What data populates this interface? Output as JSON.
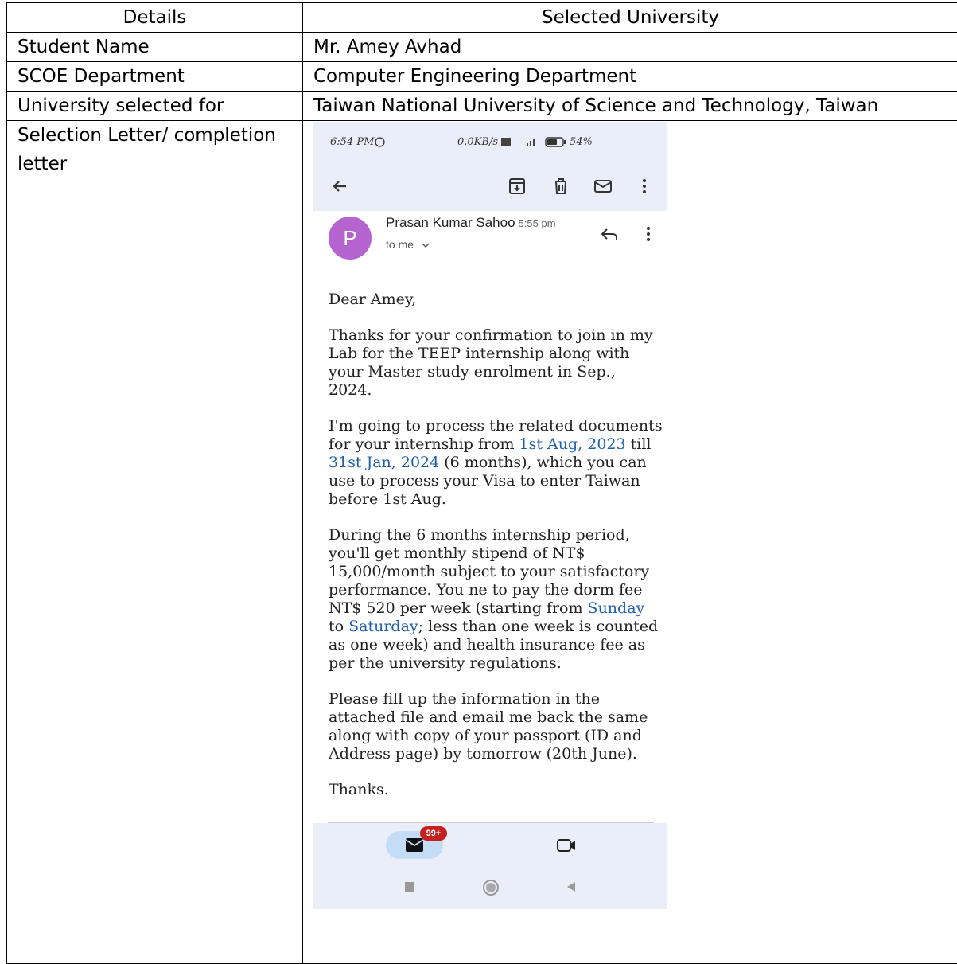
{
  "table": {
    "header": {
      "col1": "Details",
      "col2": "Selected University"
    },
    "rows": [
      {
        "label": "Student Name",
        "value": "Mr. Amey Avhad"
      },
      {
        "label": "SCOE Department",
        "value": "Computer Engineering Department"
      },
      {
        "label": "University selected for",
        "value": "Taiwan National University of Science and Technology, Taiwan"
      },
      {
        "label": "Selection Letter/ completion letter",
        "value": ""
      }
    ]
  },
  "screenshot": {
    "status": {
      "time": "6:54 PM",
      "network": "0.0KB/s",
      "battery": "54%"
    },
    "toolbar_icons": [
      "back-arrow-icon",
      "archive-icon",
      "delete-icon",
      "mark-unread-icon",
      "more-vert-icon"
    ],
    "sender": {
      "avatar_letter": "P",
      "avatar_color": "#b463cf",
      "name": "Prasan Kumar Sahoo",
      "time": "5:55 pm",
      "to": "to me"
    },
    "body": {
      "greeting": "Dear Amey,",
      "p1": "Thanks for your confirmation to join in my Lab for the TEEP internship along with your Master study enrolment in Sep., 2024.",
      "p2a": "I'm going to process the related documents for your internship from ",
      "p2_link1": "1st Aug, 2023",
      "p2b": " till ",
      "p2_link2": "31st Jan, 2024",
      "p2c": " (6 months), which you can use to process your Visa to enter Taiwan before 1st Aug.",
      "p3a": "During the 6 months internship period, you'll get monthly stipend of NT$ 15,000/month subject to your satisfactory performance. You ne to pay the dorm fee NT$ 520 per week (starting from ",
      "p3_link1": "Sunday",
      "p3b": " to ",
      "p3_link2": "Saturday",
      "p3c": "; less than one week is counted as one week) and health insurance fee as per the university regulations.",
      "p4": "Please fill up the information in the attached file and email me back the same along with copy of your passport (ID and Address page) by tomorrow (20th June).",
      "signoff": "Thanks."
    },
    "bottom_nav": {
      "mail_badge": "99+"
    },
    "colors": {
      "link": "#1f5fa8",
      "bar_bg": "#e9eef8",
      "badge": "#c5221f"
    }
  }
}
